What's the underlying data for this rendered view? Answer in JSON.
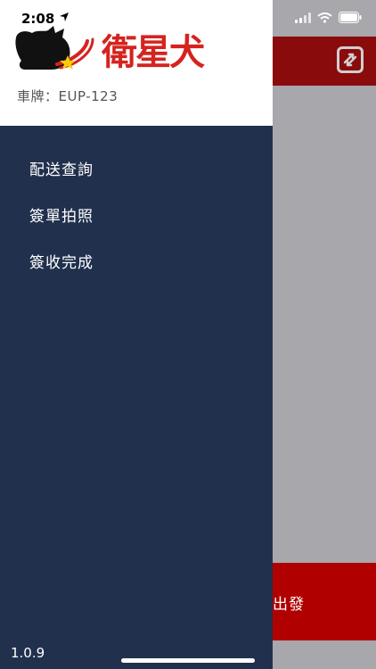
{
  "status_bar": {
    "time": "2:08"
  },
  "drawer": {
    "brand": "衛星犬",
    "plate_label": "車牌：",
    "plate_number": "EUP-123",
    "menu": [
      {
        "label": "配送查詢",
        "icon": ""
      },
      {
        "label": "簽單拍照",
        "icon": ""
      },
      {
        "label": "簽收完成",
        "icon": ""
      }
    ],
    "version": "1.0.9"
  },
  "background_app": {
    "depart_label": "出發"
  },
  "colors": {
    "drawer_bg": "#21304d",
    "brand_red": "#d5231f",
    "header_red": "#8a0b0b",
    "bottom_red": "#b00000",
    "dim_overlay": "#a8a7ab"
  }
}
